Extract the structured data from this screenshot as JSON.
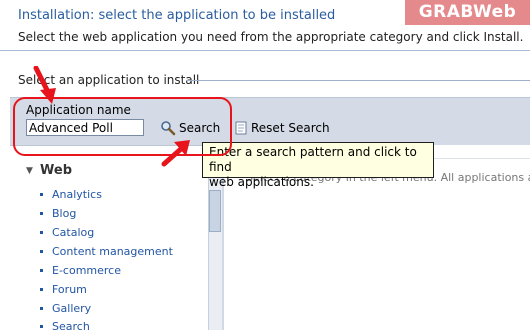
{
  "header": {
    "title": "Installation: select the application to be installed",
    "description": "Select the web application you need from the appropriate category and click Install.",
    "logo_grab": "GRAB",
    "logo_web": "Web"
  },
  "section": {
    "legend": "Select an application to install"
  },
  "search": {
    "label": "Application name",
    "value": "Advanced Poll",
    "search_button": "Search",
    "reset_button": "Reset Search"
  },
  "tooltip": {
    "line1": "Enter a search pattern and click to find",
    "line2": "web applications."
  },
  "categories": {
    "title": "Web",
    "items": [
      "Analytics",
      "Blog",
      "Catalog",
      "Content management",
      "E-commerce",
      "Forum",
      "Gallery",
      "Search"
    ]
  },
  "right_panel": {
    "message": "Select a category in the left menu. All applications a"
  },
  "colors": {
    "annotation": "#e8141b",
    "title": "#2a5d9f",
    "link": "#2255a4"
  },
  "icons": {
    "search": "magnifier-icon",
    "reset": "page-icon",
    "arrow": "red-arrow-icon",
    "toggle": "triangle-down-icon"
  }
}
